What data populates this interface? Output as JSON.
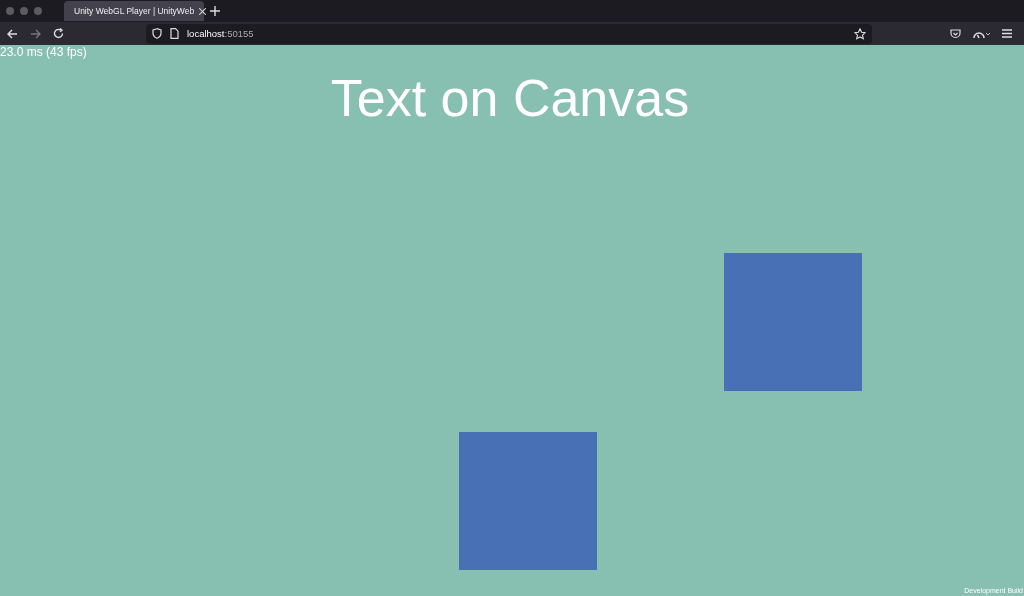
{
  "browser": {
    "tabs": [
      {
        "title": "Unity WebGL Player | UnityWeb",
        "selected": true
      }
    ],
    "address": {
      "host": "localhost",
      "port": ":50155"
    }
  },
  "canvas": {
    "fps_counter": "23.0 ms (43 fps)",
    "title": "Text on Canvas",
    "squares": [
      {
        "color": "#4870b4"
      },
      {
        "color": "#4870b4"
      }
    ],
    "build_label": "Development Build"
  }
}
